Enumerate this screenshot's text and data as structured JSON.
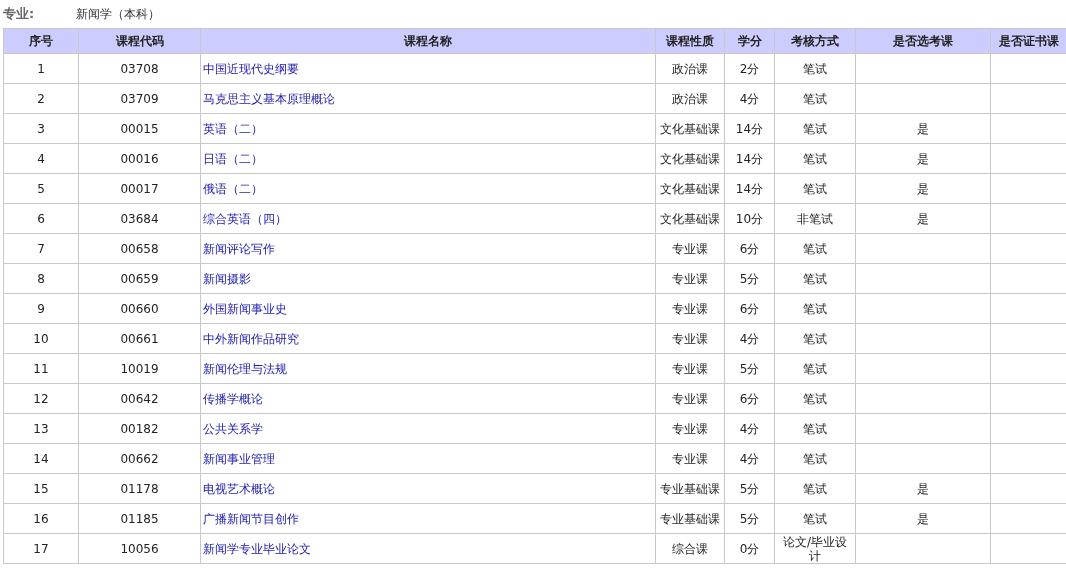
{
  "major": {
    "label": "专业:",
    "value": "新闻学（本科）"
  },
  "table": {
    "columns": [
      "序号",
      "课程代码",
      "课程名称",
      "课程性质",
      "学分",
      "考核方式",
      "是否选考课",
      "是否证书课"
    ],
    "rows": [
      {
        "no": "1",
        "code": "03708",
        "name": "中国近现代史纲要",
        "type": "政治课",
        "credits": "2分",
        "exam": "笔试"
      },
      {
        "no": "2",
        "code": "03709",
        "name": "马克思主义基本原理概论",
        "type": "政治课",
        "credits": "4分",
        "exam": "笔试"
      },
      {
        "no": "3",
        "code": "00015",
        "name": "英语（二）",
        "type": "文化基础课",
        "credits": "14分",
        "exam": "笔试",
        "elective": "是"
      },
      {
        "no": "4",
        "code": "00016",
        "name": "日语（二）",
        "type": "文化基础课",
        "credits": "14分",
        "exam": "笔试",
        "elective": "是"
      },
      {
        "no": "5",
        "code": "00017",
        "name": "俄语（二）",
        "type": "文化基础课",
        "credits": "14分",
        "exam": "笔试",
        "elective": "是"
      },
      {
        "no": "6",
        "code": "03684",
        "name": "综合英语（四）",
        "type": "文化基础课",
        "credits": "10分",
        "exam": "非笔试",
        "elective": "是"
      },
      {
        "no": "7",
        "code": "00658",
        "name": "新闻评论写作",
        "type": "专业课",
        "credits": "6分",
        "exam": "笔试"
      },
      {
        "no": "8",
        "code": "00659",
        "name": "新闻摄影",
        "type": "专业课",
        "credits": "5分",
        "exam": "笔试"
      },
      {
        "no": "9",
        "code": "00660",
        "name": "外国新闻事业史",
        "type": "专业课",
        "credits": "6分",
        "exam": "笔试"
      },
      {
        "no": "10",
        "code": "00661",
        "name": "中外新闻作品研究",
        "type": "专业课",
        "credits": "4分",
        "exam": "笔试"
      },
      {
        "no": "11",
        "code": "10019",
        "name": "新闻伦理与法规",
        "type": "专业课",
        "credits": "5分",
        "exam": "笔试"
      },
      {
        "no": "12",
        "code": "00642",
        "name": "传播学概论",
        "type": "专业课",
        "credits": "6分",
        "exam": "笔试"
      },
      {
        "no": "13",
        "code": "00182",
        "name": "公共关系学",
        "type": "专业课",
        "credits": "4分",
        "exam": "笔试"
      },
      {
        "no": "14",
        "code": "00662",
        "name": "新闻事业管理",
        "type": "专业课",
        "credits": "4分",
        "exam": "笔试"
      },
      {
        "no": "15",
        "code": "01178",
        "name": "电视艺术概论",
        "type": "专业基础课",
        "credits": "5分",
        "exam": "笔试",
        "elective": "是"
      },
      {
        "no": "16",
        "code": "01185",
        "name": "广播新闻节目创作",
        "type": "专业基础课",
        "credits": "5分",
        "exam": "笔试",
        "elective": "是"
      },
      {
        "no": "17",
        "code": "10056",
        "name": "新闻学专业毕业论文",
        "type": "综合课",
        "credits": "0分",
        "exam": "论文/毕业设计"
      }
    ]
  }
}
